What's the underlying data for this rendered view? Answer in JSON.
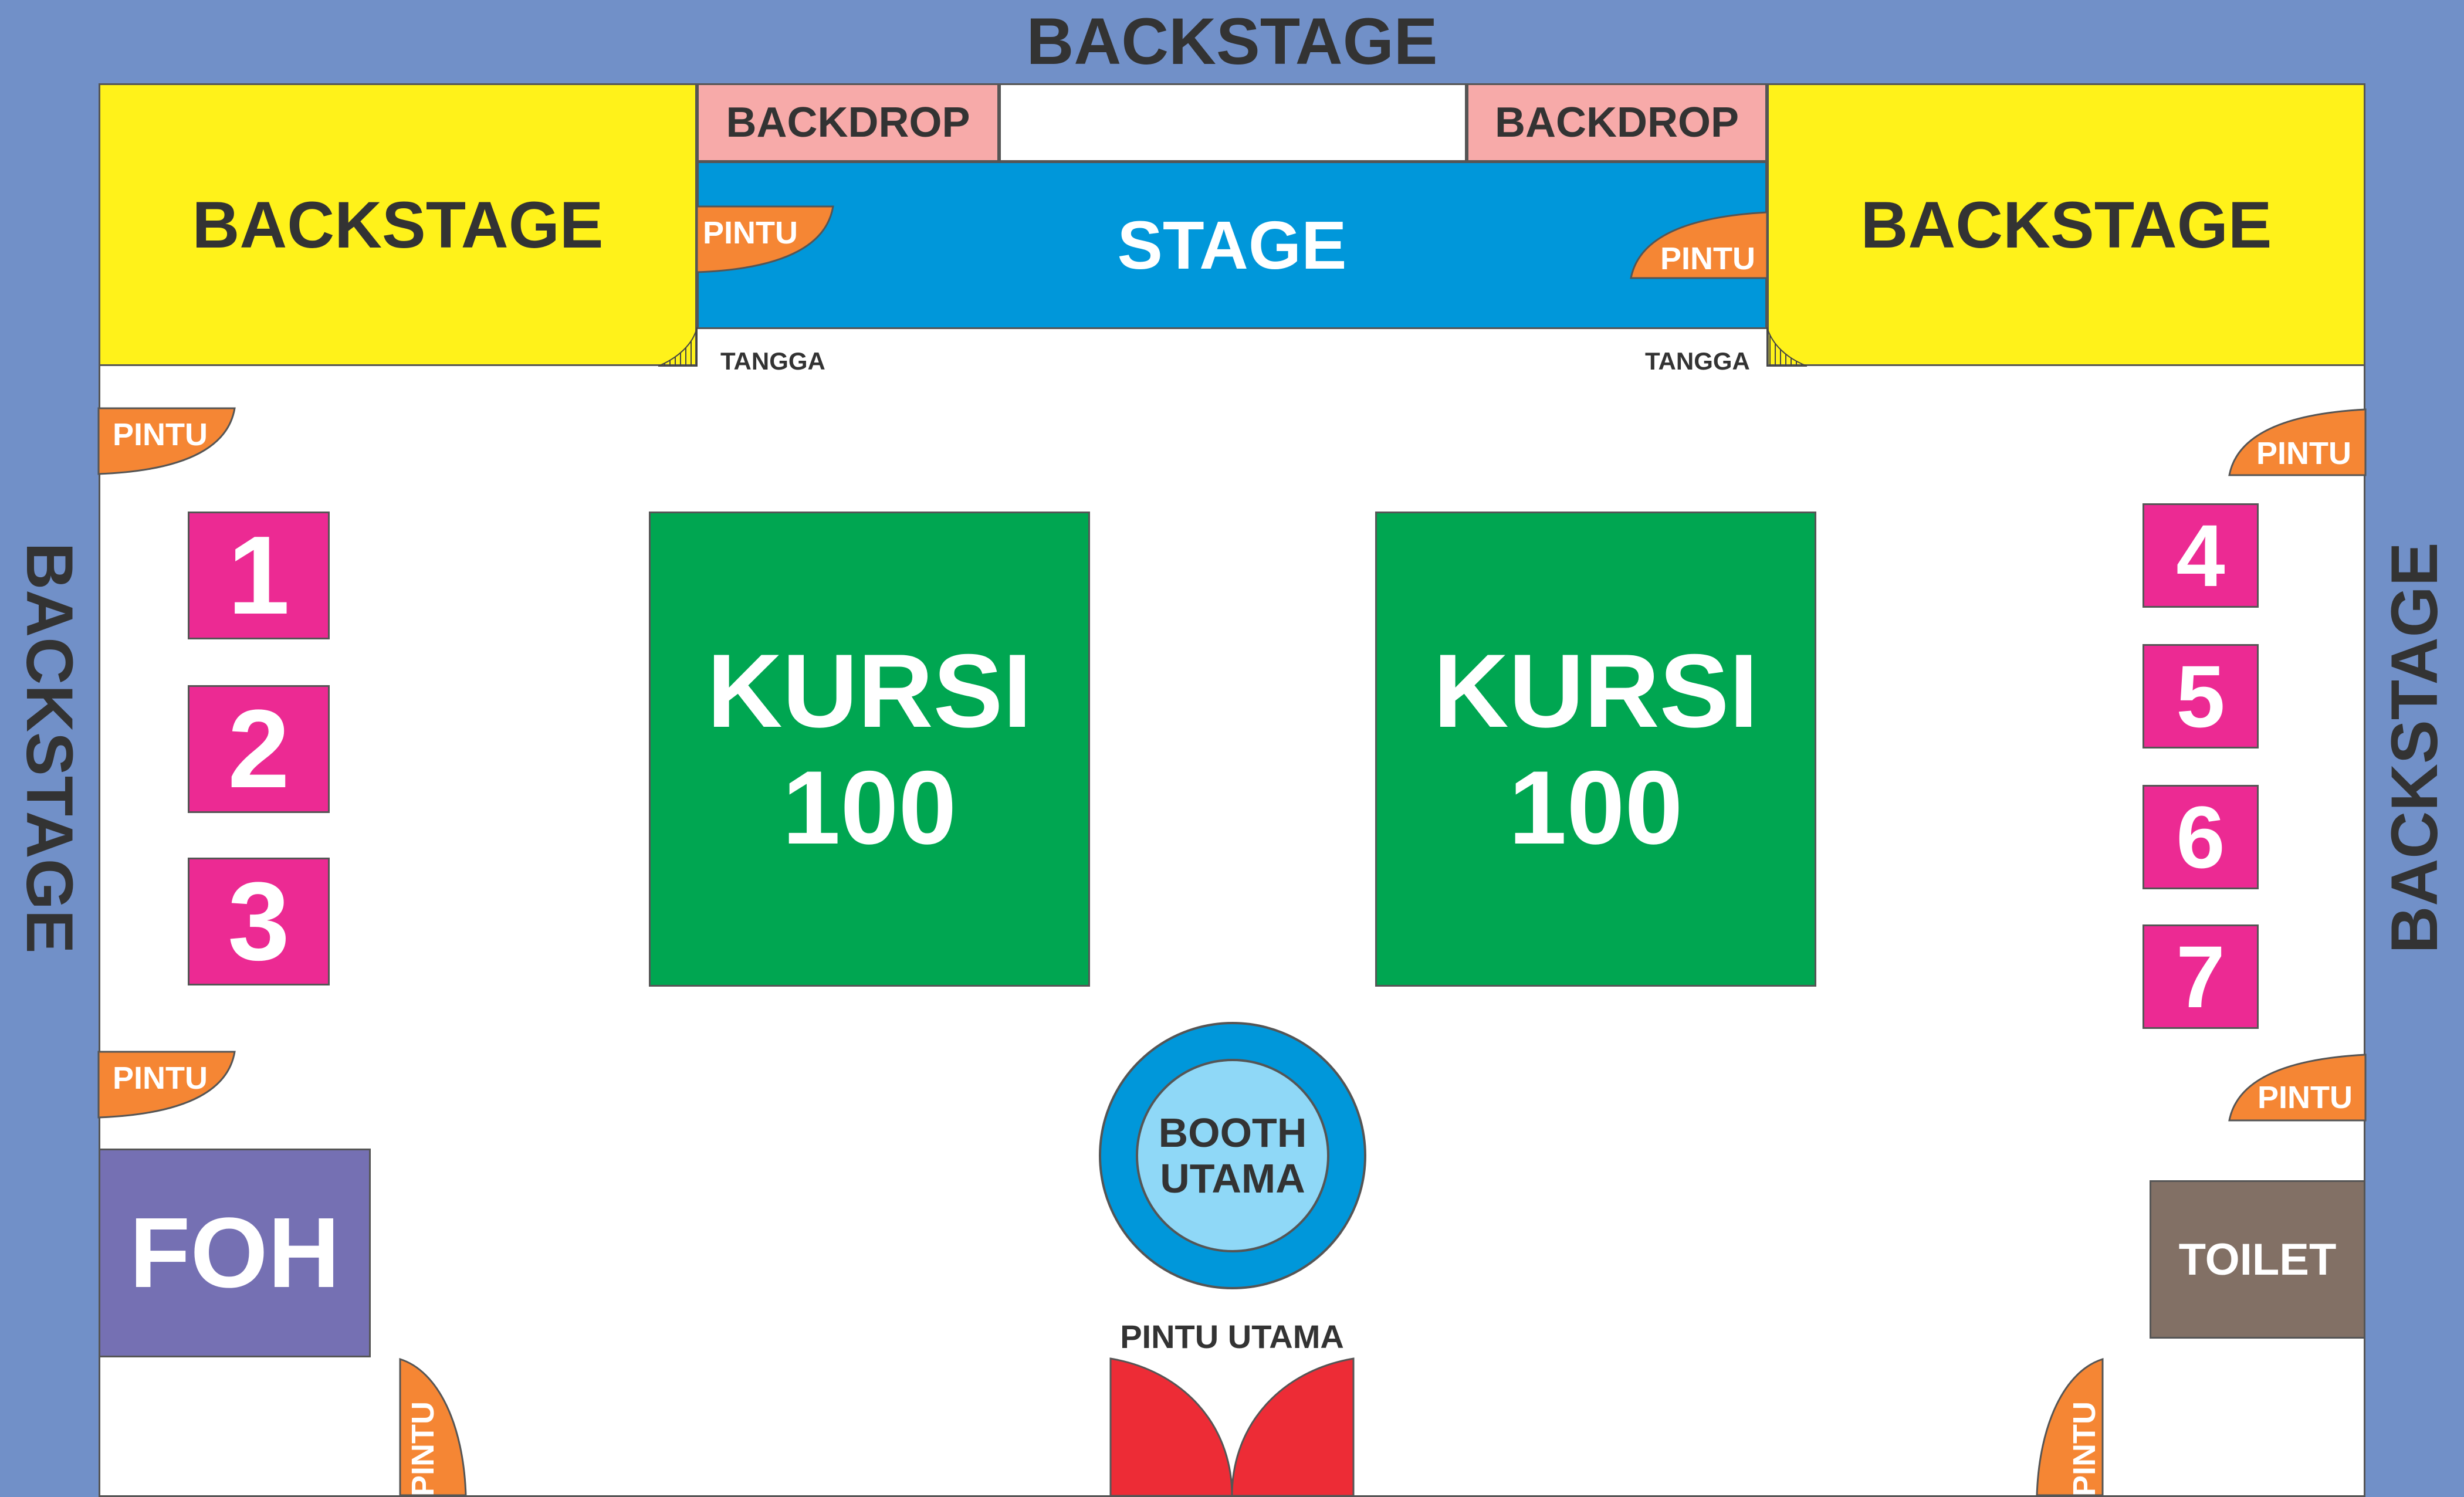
{
  "edges": {
    "top": "BACKSTAGE",
    "left": "BACKSTAGE",
    "right": "BACKSTAGE"
  },
  "backstage_rooms": {
    "left": "BACKSTAGE",
    "right": "BACKSTAGE"
  },
  "backdrops": {
    "left": "BACKDROP",
    "right": "BACKDROP"
  },
  "stage": {
    "label": "STAGE"
  },
  "stairs": {
    "left": "TANGGA",
    "right": "TANGGA"
  },
  "doors": {
    "stage_left": "PINTU",
    "stage_right": "PINTU",
    "left_upper": "PINTU",
    "left_middle": "PINTU",
    "left_bottom": "PINTU",
    "right_upper": "PINTU",
    "right_middle": "PINTU",
    "right_bottom": "PINTU"
  },
  "booths": [
    "1",
    "2",
    "3",
    "4",
    "5",
    "6",
    "7"
  ],
  "seating": [
    {
      "line1": "KURSI",
      "line2": "100"
    },
    {
      "line1": "KURSI",
      "line2": "100"
    }
  ],
  "main_booth": {
    "line1": "BOOTH",
    "line2": "UTAMA"
  },
  "main_entrance": {
    "label": "PINTU UTAMA"
  },
  "foh": {
    "label": "FOH"
  },
  "toilet": {
    "label": "TOILET"
  },
  "colors": {
    "outer": "#7190c8",
    "backstage": "#fff21a",
    "backdrop": "#f7aaa9",
    "stage": "#0097da",
    "door": "#f58634",
    "booth": "#ec2a93",
    "seating": "#00a651",
    "main_booth_outer": "#0097da",
    "main_booth_inner": "#8fd8f7",
    "main_door": "#ed2c36",
    "foh": "#7570b3",
    "toilet": "#827065"
  }
}
